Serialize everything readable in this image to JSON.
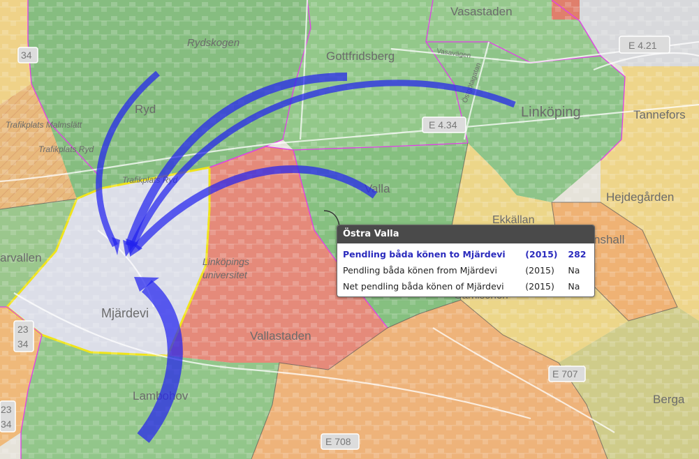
{
  "places": {
    "vasastaden": "Vasastaden",
    "rydskogen": "Rydskogen",
    "gottfridsberg": "Gottfridsberg",
    "vasavagen": "Vasavägen",
    "ostgotagatan": "Östgötagatan",
    "linkoping": "Linköping",
    "tanneforsn": "Tannefors",
    "ryd": "Ryd",
    "trafikplats_malmslatt": "Trafikplats Malmslätt",
    "trafikplats_ryd": "Trafikplats Ryd",
    "trafikplats_ryd2": "Trafikplats Ryd",
    "hejdegarden": "Hejdegården",
    "valla": "Valla",
    "ekkallan": "Ekkällan",
    "nshall": "nshall",
    "karvallen": "arvallen",
    "linkopings_universitet_1": "Linköpings",
    "linkopings_universitet_2": "universitet",
    "mjardevi": "Mjärdevi",
    "garnisonen": "Garnisonen",
    "vallastaden": "Vallastaden",
    "lambohov": "Lambohov",
    "berga": "Berga",
    "ryd_road": "Ryd"
  },
  "road_shields": {
    "e421": "E 4.21",
    "e4_34": "E 4.34",
    "e707": "E 707",
    "e708": "E 708",
    "r34_top": "34",
    "r23": "23",
    "r34_mid": "34",
    "r23b": "23",
    "r34_bot": "34"
  },
  "tooltip": {
    "title": "Östra Valla",
    "rows": [
      {
        "label": "Pendling båda könen to Mjärdevi",
        "year": "(2015)",
        "value": "282",
        "highlight": true
      },
      {
        "label": "Pendling båda könen from Mjärdevi",
        "year": "(2015)",
        "value": "Na",
        "highlight": false
      },
      {
        "label": "Net pendling båda könen of Mjärdevi",
        "year": "(2015)",
        "value": "Na",
        "highlight": false
      }
    ]
  },
  "colors": {
    "green_zone": "#8fc48a",
    "red_zone": "#e58a7a",
    "orange_zone": "#efb97a",
    "yellow_zone": "#efd98a",
    "selected_zone": "#d9dce6",
    "selected_border": "#f2e400",
    "zone_border": "#e03ce6",
    "flow_arrow": "#2222ee"
  }
}
